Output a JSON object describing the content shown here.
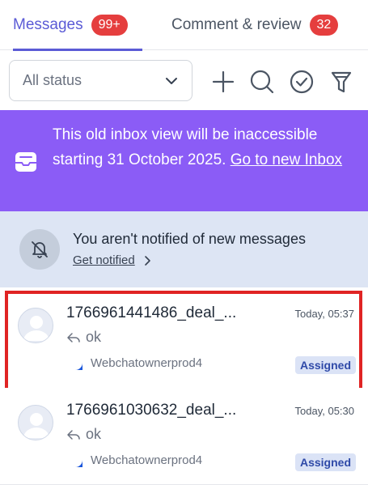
{
  "tabs": [
    {
      "label": "Messages",
      "badge": "99+"
    },
    {
      "label": "Comment & review",
      "badge": "32"
    }
  ],
  "toolbar": {
    "status_value": "All status",
    "icons": [
      "plus-icon",
      "search-icon",
      "check-circle-icon",
      "filter-icon"
    ]
  },
  "banner": {
    "text": "This old inbox view will be inaccessible starting 31 October 2025. ",
    "link": "Go to new Inbox"
  },
  "notify": {
    "title": "You aren't notified of new messages",
    "link": "Get notified"
  },
  "conversations": [
    {
      "title": "1766961441486_deal_...",
      "time": "Today, 05:37",
      "preview": "ok",
      "channel": "Webchatownerprod4",
      "status": "Assigned"
    },
    {
      "title": "1766961030632_deal_...",
      "time": "Today, 05:30",
      "preview": "ok",
      "channel": "Webchatownerprod4",
      "status": "Assigned"
    }
  ],
  "colors": {
    "accent": "#5b5bd6",
    "badge": "#e53e3e",
    "banner": "#8b5cf6",
    "notify_bg": "#dde5f4",
    "highlight": "#e02424"
  }
}
